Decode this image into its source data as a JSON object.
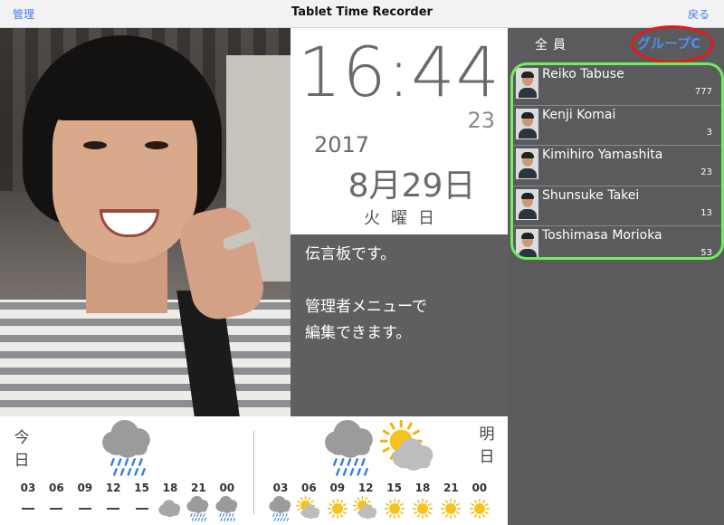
{
  "topbar": {
    "left_label": "管理",
    "title": "Tablet Time Recorder",
    "right_label": "戻る"
  },
  "clock": {
    "time": "16:44",
    "seconds": "23",
    "year": "2017",
    "date": "8月29日",
    "weekday": "火曜日"
  },
  "message": {
    "text": "伝言板です。\n\n管理者メニューで\n編集できます。"
  },
  "staff": {
    "tab_all": "全員",
    "tab_group": "グループC",
    "highlight_colors": {
      "group_ring": "#e81919",
      "list_ring": "#6cf05c"
    },
    "members": [
      {
        "name": "Reiko Tabuse",
        "count": "777"
      },
      {
        "name": "Kenji Komai",
        "count": "3"
      },
      {
        "name": "Kimihiro Yamashita",
        "count": "23"
      },
      {
        "name": "Shunsuke Takei",
        "count": "13"
      },
      {
        "name": "Toshimasa Morioka",
        "count": "53"
      }
    ]
  },
  "weather": {
    "today_label": "今日",
    "tomorrow_label": "明日",
    "today_icon": "rain-cloud-icon",
    "tomorrow_icons": [
      "rain-cloud-icon",
      "sun-cloud-icon"
    ],
    "today_hours": [
      {
        "hour": "03",
        "icon": "none"
      },
      {
        "hour": "06",
        "icon": "none"
      },
      {
        "hour": "09",
        "icon": "none"
      },
      {
        "hour": "12",
        "icon": "none"
      },
      {
        "hour": "15",
        "icon": "none"
      },
      {
        "hour": "18",
        "icon": "cloud-icon"
      },
      {
        "hour": "21",
        "icon": "rain-cloud-icon"
      },
      {
        "hour": "00",
        "icon": "rain-cloud-icon"
      }
    ],
    "tomorrow_hours": [
      {
        "hour": "03",
        "icon": "rain-cloud-icon"
      },
      {
        "hour": "06",
        "icon": "sun-cloud-icon"
      },
      {
        "hour": "09",
        "icon": "sun-icon"
      },
      {
        "hour": "12",
        "icon": "sun-cloud-icon"
      },
      {
        "hour": "15",
        "icon": "sun-icon"
      },
      {
        "hour": "18",
        "icon": "sun-icon"
      },
      {
        "hour": "21",
        "icon": "sun-icon"
      },
      {
        "hour": "00",
        "icon": "sun-icon"
      }
    ]
  }
}
